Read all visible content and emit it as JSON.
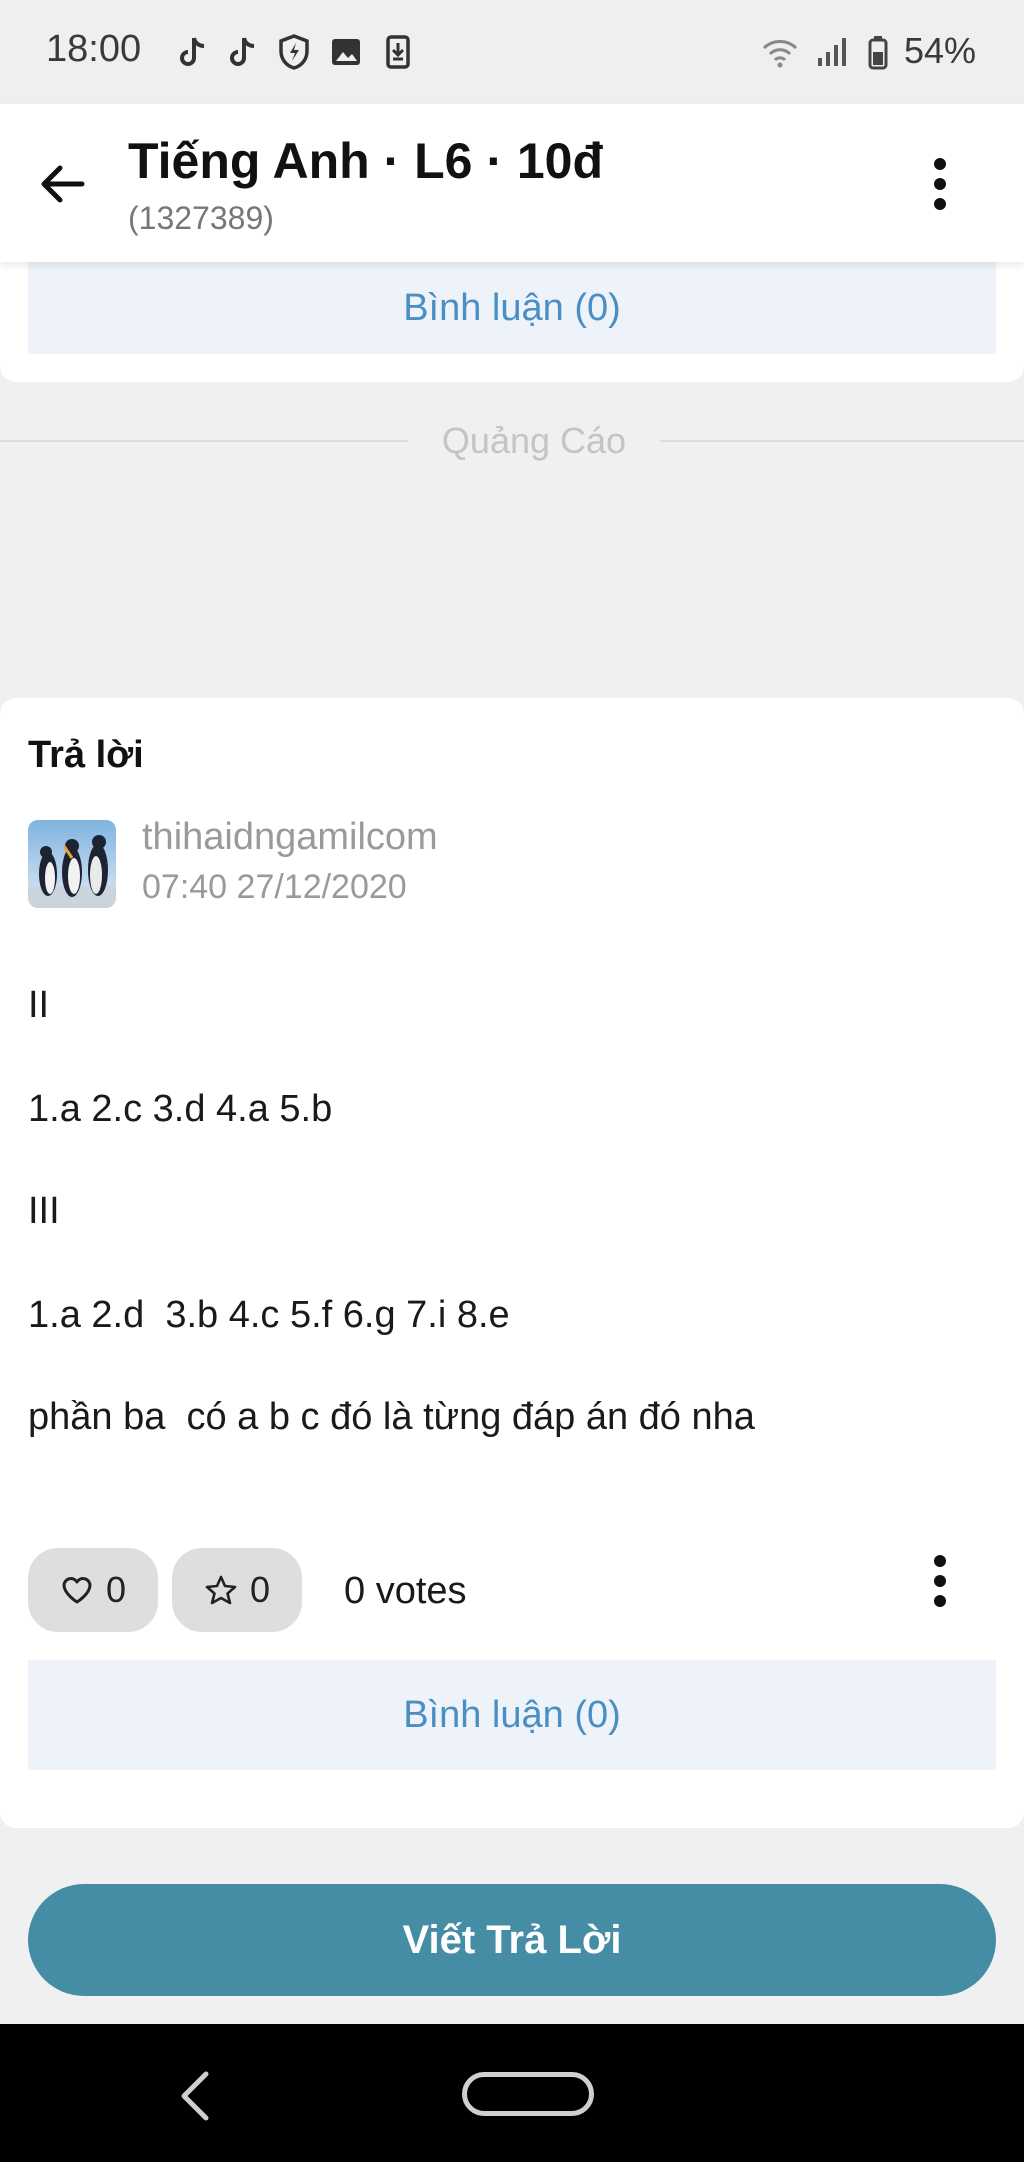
{
  "status_bar": {
    "time": "18:00",
    "battery": "54%",
    "icons": [
      "tiktok-icon",
      "tiktok-icon",
      "shield-icon",
      "image-icon",
      "download-icon",
      "wifi-icon",
      "signal-icon",
      "battery-icon"
    ]
  },
  "header": {
    "title": "Tiếng Anh · L6 · 10đ",
    "subtitle": "(1327389)"
  },
  "top_card": {
    "comment_label": "Bình luận (0)"
  },
  "ad": {
    "label": "Quảng Cáo"
  },
  "answer": {
    "heading": "Trả lời",
    "username": "thihaidngamilcom",
    "timestamp": "07:40 27/12/2020",
    "lines": [
      "II",
      "1.a 2.c 3.d 4.a 5.b",
      "III",
      "1.a 2.d  3.b 4.c 5.f 6.g 7.i 8.e",
      "phần ba  có a b c đó là từng đáp án đó nha"
    ],
    "likes": "0",
    "stars": "0",
    "votes": "0 votes",
    "comment_label": "Bình luận (0)"
  },
  "write_answer_label": "Viết Trả Lời",
  "colors": {
    "accent": "#458ca5",
    "link": "#4a8fc4",
    "comment_bg": "#eef3f9"
  }
}
